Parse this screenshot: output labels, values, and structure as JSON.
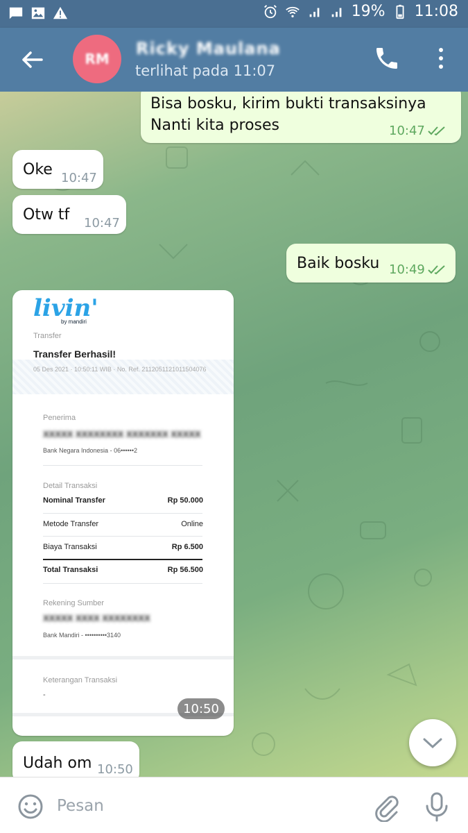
{
  "status_bar": {
    "battery": "19%",
    "time": "11:08"
  },
  "header": {
    "avatar_initials": "RM",
    "contact_name": "Ricky Maulana",
    "contact_status": "terlihat pada 11:07"
  },
  "messages": [
    {
      "direction": "out",
      "lines": [
        "Bisa bosku, kirim bukti transaksinya",
        "Nanti kita proses"
      ],
      "time": "10:47"
    },
    {
      "direction": "in",
      "text": "Oke",
      "time": "10:47"
    },
    {
      "direction": "in",
      "text": "Otw tf",
      "time": "10:47"
    },
    {
      "direction": "out",
      "text": "Baik bosku",
      "time": "10:49"
    },
    {
      "direction": "in",
      "text": "Udah om",
      "time": "10:50"
    }
  ],
  "receipt": {
    "logo": "livin'",
    "logo_sub": "by mandiri",
    "section": "Transfer",
    "title": "Transfer Berhasil!",
    "meta": "05 Des 2021 · 10:50:11 WIB · No. Ref. 2112051121011504076",
    "recipient_label": "Penerima",
    "recipient_name": "XXXXX XXXXXXXX XXXXXXX XXXXX",
    "recipient_bank": "Bank Negara Indonesia - 06••••••2",
    "detail_label": "Detail Transaksi",
    "rows": [
      {
        "label": "Nominal Transfer",
        "value": "Rp 50.000",
        "bold": true
      },
      {
        "label": "Metode Transfer",
        "value": "Online",
        "bold": false
      },
      {
        "label": "Biaya Transaksi",
        "value": "Rp 6.500",
        "bold": false
      },
      {
        "label": "Total Transaksi",
        "value": "Rp 56.500",
        "bold": true
      }
    ],
    "source_label": "Rekening Sumber",
    "source_name": "XXXXX XXXX XXXXXXXX",
    "source_bank": "Bank Mandiri - ••••••••••3140",
    "note_label": "Keterangan Transaksi",
    "note_value": "-",
    "time": "10:50"
  },
  "input": {
    "placeholder": "Pesan"
  },
  "colors": {
    "header": "#527da3",
    "status_bar": "#4a6f92",
    "out_bubble": "#efffde",
    "in_bubble": "#ffffff",
    "accent_tick": "#5ea85f"
  }
}
